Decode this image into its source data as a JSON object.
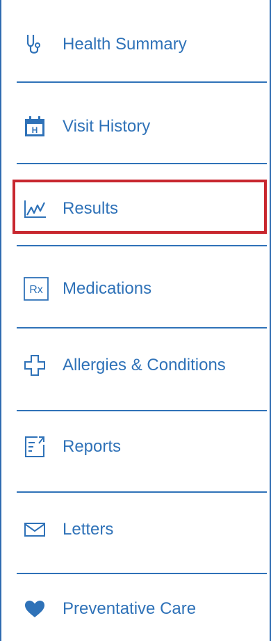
{
  "nav": {
    "items": [
      {
        "label": "Health Summary",
        "icon": "stethoscope-icon"
      },
      {
        "label": "Visit History",
        "icon": "calendar-icon"
      },
      {
        "label": "Results",
        "icon": "line-chart-icon",
        "selected": true
      },
      {
        "label": "Medications",
        "icon": "rx-icon"
      },
      {
        "label": "Allergies & Conditions",
        "icon": "medical-cross-icon"
      },
      {
        "label": "Reports",
        "icon": "report-icon"
      },
      {
        "label": "Letters",
        "icon": "envelope-icon"
      },
      {
        "label": "Preventative Care",
        "icon": "heart-icon"
      }
    ],
    "icon_text": {
      "calendar_letter": "H",
      "rx": "Rx"
    }
  },
  "colors": {
    "link": "#2f72b8",
    "border": "#2f6bb0",
    "selected_outline": "#c8272f"
  }
}
